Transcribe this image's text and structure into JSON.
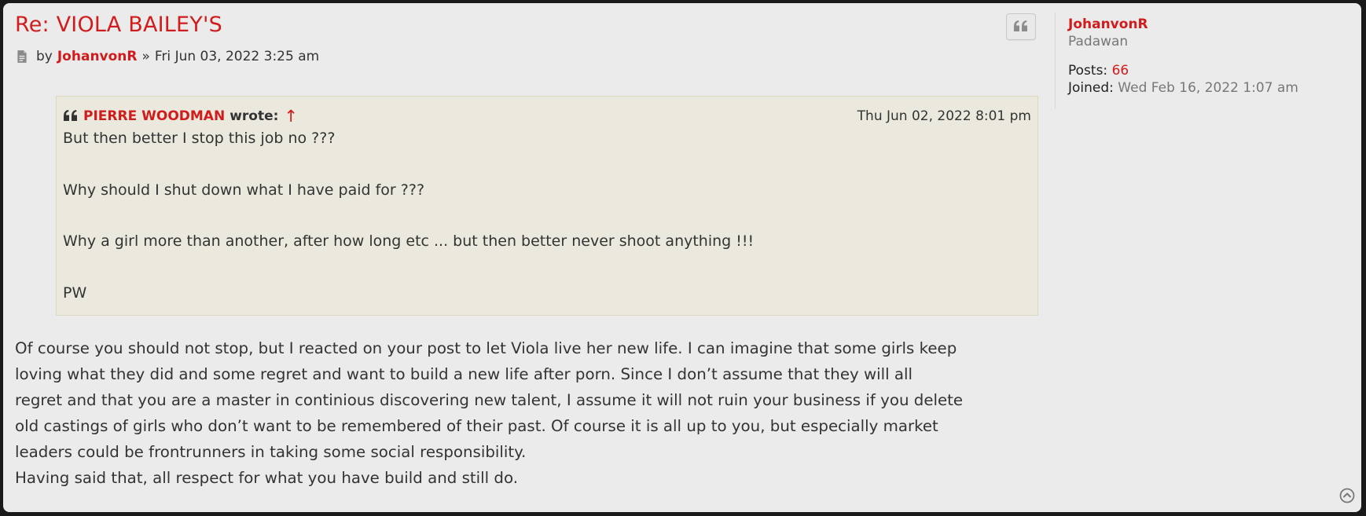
{
  "post": {
    "title": "Re: VIOLA BAILEY'S",
    "by_label": "by",
    "author": "JohanvonR",
    "separator": "»",
    "date": "Fri Jun 03, 2022 3:25 am"
  },
  "quote": {
    "author": "PIERRE WOODMAN",
    "wrote_label": "wrote:",
    "arrow": "↑",
    "date": "Thu Jun 02, 2022 8:01 pm",
    "lines": [
      "But then better I stop this job no ???",
      "Why should I shut down what I have paid for ???",
      "Why a girl more than another, after how long etc ... but then better never shoot anything !!!",
      "PW"
    ]
  },
  "content": {
    "line1": "Of course you should not stop, but I reacted on your post to let Viola live her new life. I can imagine that some girls keep",
    "line2": "loving what they did and some regret and want to build a new life after porn. Since I don’t assume that they will all",
    "line3": "regret and that you are a master in continious discovering new talent, I assume it will not ruin your business if you delete",
    "line4": "old castings of girls who don’t want to be remembered of their past. Of course it is all up to you, but especially market",
    "line5": "leaders could be frontrunners in taking some social responsibility.",
    "line6": "Having said that, all respect for what you have build and still do."
  },
  "profile": {
    "username": "JohanvonR",
    "rank": "Padawan",
    "posts_label": "Posts:",
    "posts_value": "66",
    "joined_label": "Joined:",
    "joined_value": "Wed Feb 16, 2022 1:07 am"
  },
  "icons": {
    "post_icon": "document-icon",
    "quote_button": "quote-icon",
    "quote_head": "quote-icon",
    "back_to_top": "chevron-up-circle-icon"
  },
  "colors": {
    "accent": "#d01c1c",
    "post_bg": "#ebebeb",
    "quote_bg": "#ebe9dd",
    "text": "#333333"
  }
}
